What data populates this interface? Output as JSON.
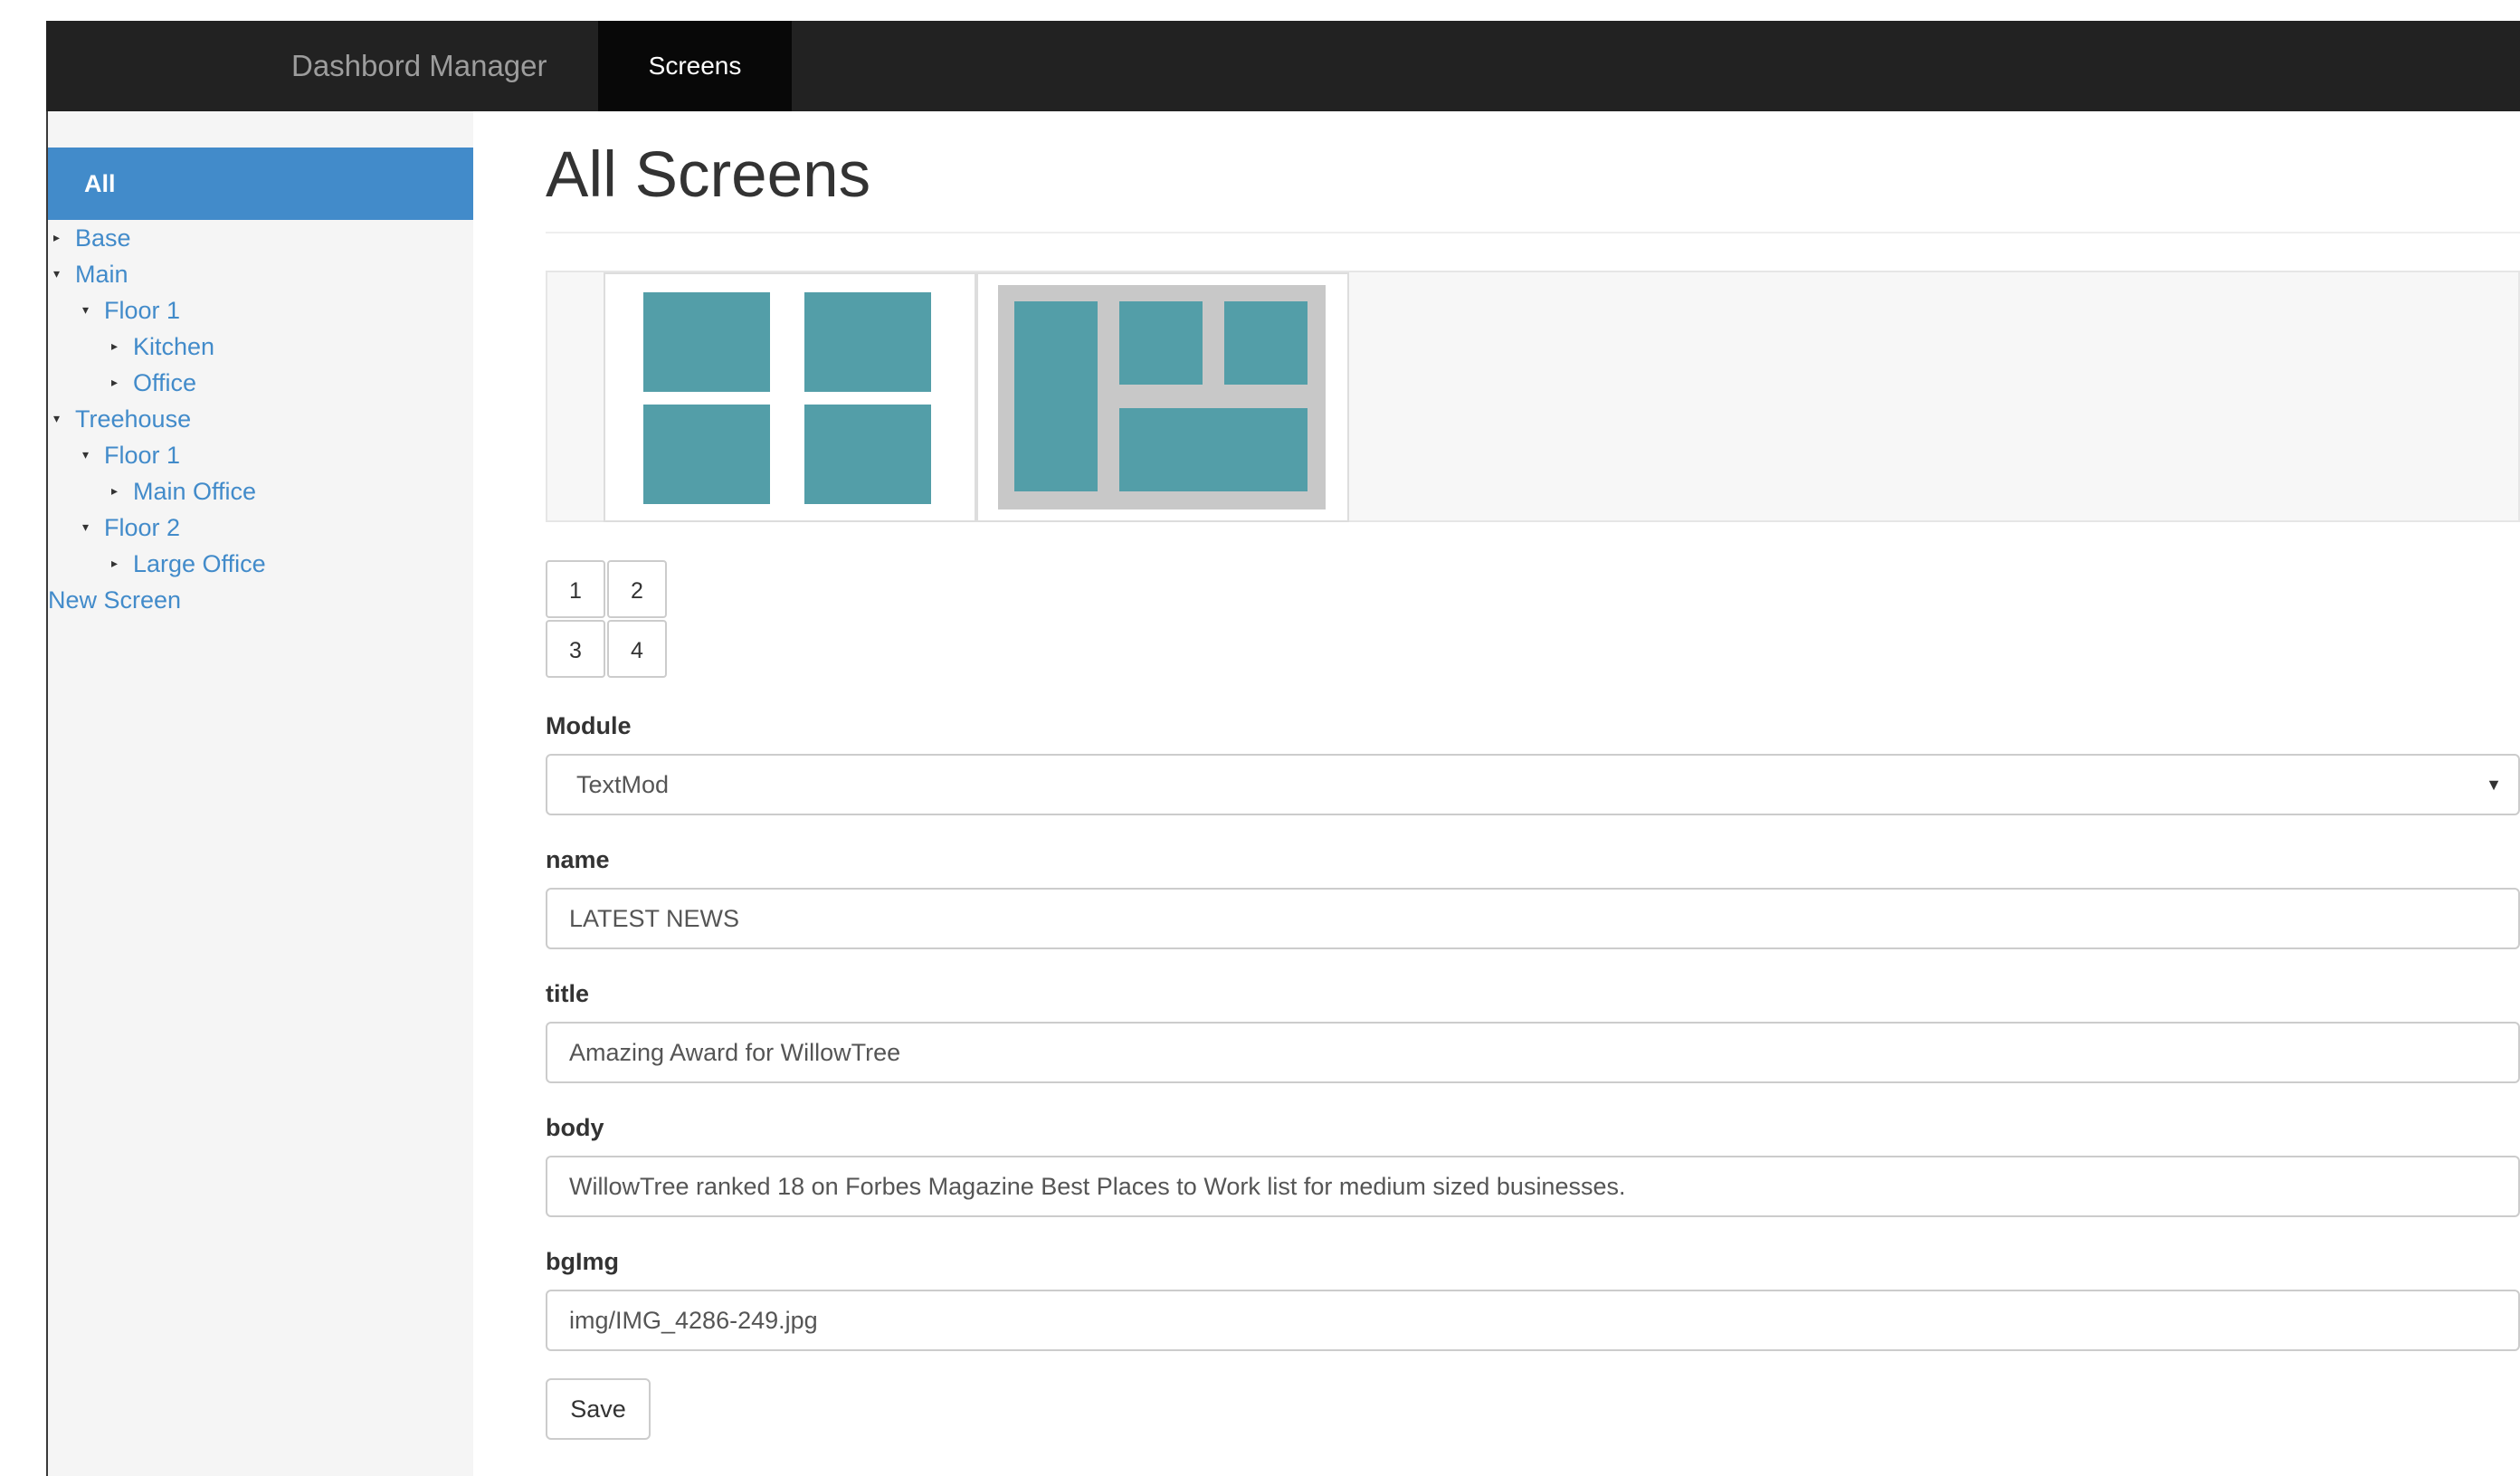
{
  "navbar": {
    "brand": "Dashbord Manager",
    "active_tab": "Screens"
  },
  "sidebar": {
    "active_item": "All",
    "tree": [
      {
        "label": "Base",
        "depth": 0,
        "expanded": false
      },
      {
        "label": "Main",
        "depth": 0,
        "expanded": true
      },
      {
        "label": "Floor 1",
        "depth": 1,
        "expanded": true
      },
      {
        "label": "Kitchen",
        "depth": 2,
        "expanded": false
      },
      {
        "label": "Office",
        "depth": 2,
        "expanded": false
      },
      {
        "label": "Treehouse",
        "depth": 0,
        "expanded": true
      },
      {
        "label": "Floor 1",
        "depth": 1,
        "expanded": true
      },
      {
        "label": "Main Office",
        "depth": 2,
        "expanded": false
      },
      {
        "label": "Floor 2",
        "depth": 1,
        "expanded": true
      },
      {
        "label": "Large Office",
        "depth": 2,
        "expanded": false
      }
    ],
    "new_screen": "New Screen"
  },
  "main": {
    "title": "All Screens",
    "layout_thumbnails": [
      "grid-2x2",
      "sidebar-split"
    ],
    "selected_layout": "sidebar-split",
    "pager": [
      "1",
      "2",
      "3",
      "4"
    ],
    "form": {
      "module": {
        "label": "Module",
        "value": "TextMod"
      },
      "name": {
        "label": "name",
        "value": "LATEST NEWS"
      },
      "title": {
        "label": "title",
        "value": "Amazing Award for WillowTree"
      },
      "body": {
        "label": "body",
        "value": "WillowTree ranked 18 on Forbes Magazine Best Places to Work list for medium sized businesses."
      },
      "bgimg": {
        "label": "bgImg",
        "value": "img/IMG_4286-249.jpg"
      },
      "save": "Save"
    }
  },
  "colors": {
    "navbar": "#222222",
    "accent": "#428bca",
    "tile": "#539ea8",
    "link": "#428bca"
  }
}
